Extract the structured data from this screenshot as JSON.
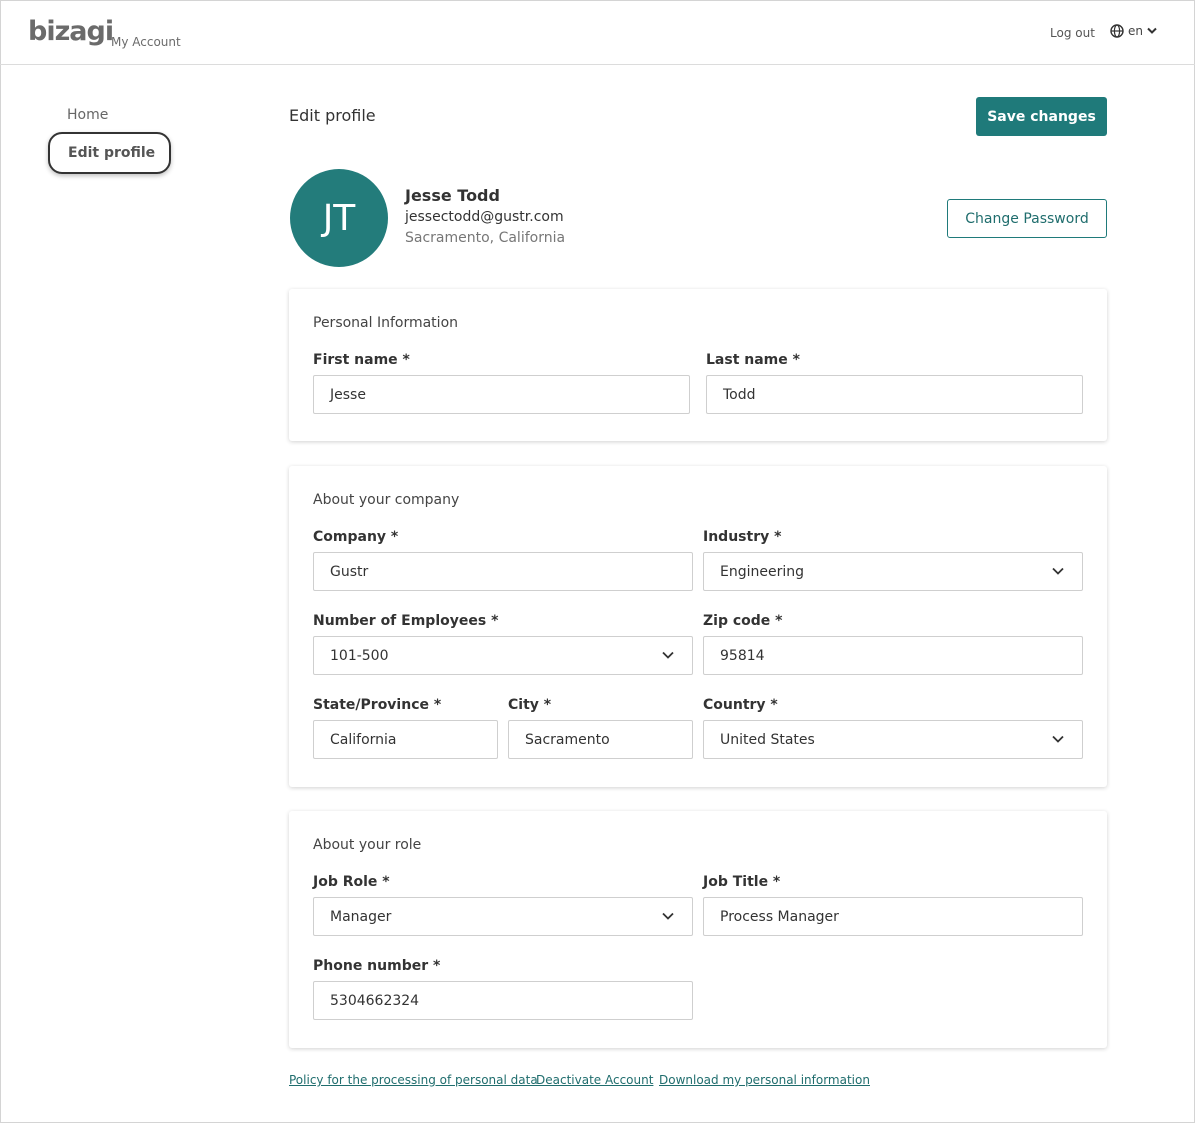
{
  "header": {
    "logo": "bizagi",
    "subtitle": "My Account",
    "logout": "Log out",
    "language": "en",
    "icons": {
      "language": "globe-icon",
      "dropdown": "chevron-down-icon"
    }
  },
  "sidebar": {
    "items": [
      {
        "label": "Home",
        "selected": false
      },
      {
        "label": "Edit profile",
        "selected": true
      }
    ]
  },
  "main": {
    "title": "Edit profile",
    "save_label": "Save changes",
    "change_password_label": "Change Password"
  },
  "profile": {
    "initials": "JT",
    "name": "Jesse Todd",
    "email": "jessectodd@gustr.com",
    "location": "Sacramento, California",
    "avatar_color": "#237c7b"
  },
  "personal": {
    "title": "Personal Information",
    "first_name_label": "First name *",
    "first_name": "Jesse",
    "last_name_label": "Last name *",
    "last_name": "Todd"
  },
  "company": {
    "title": "About your company",
    "company_label": "Company *",
    "company": "Gustr",
    "industry_label": "Industry *",
    "industry": "Engineering",
    "employees_label": "Number of Employees *",
    "employees": "101-500",
    "zip_label": "Zip code *",
    "zip": "95814",
    "state_label": "State/Province *",
    "state": "California",
    "city_label": "City *",
    "city": "Sacramento",
    "country_label": "Country *",
    "country": "United States"
  },
  "role": {
    "title": "About your role",
    "job_role_label": "Job Role *",
    "job_role": "Manager",
    "job_title_label": "Job Title *",
    "job_title": "Process Manager",
    "phone_label": "Phone number *",
    "phone": "5304662324"
  },
  "footer": {
    "policy": "Policy for the processing of personal data",
    "deactivate": "Deactivate Account",
    "download": "Download my personal information"
  },
  "colors": {
    "accent": "#1f7a7a",
    "link": "#1f6d6d"
  }
}
